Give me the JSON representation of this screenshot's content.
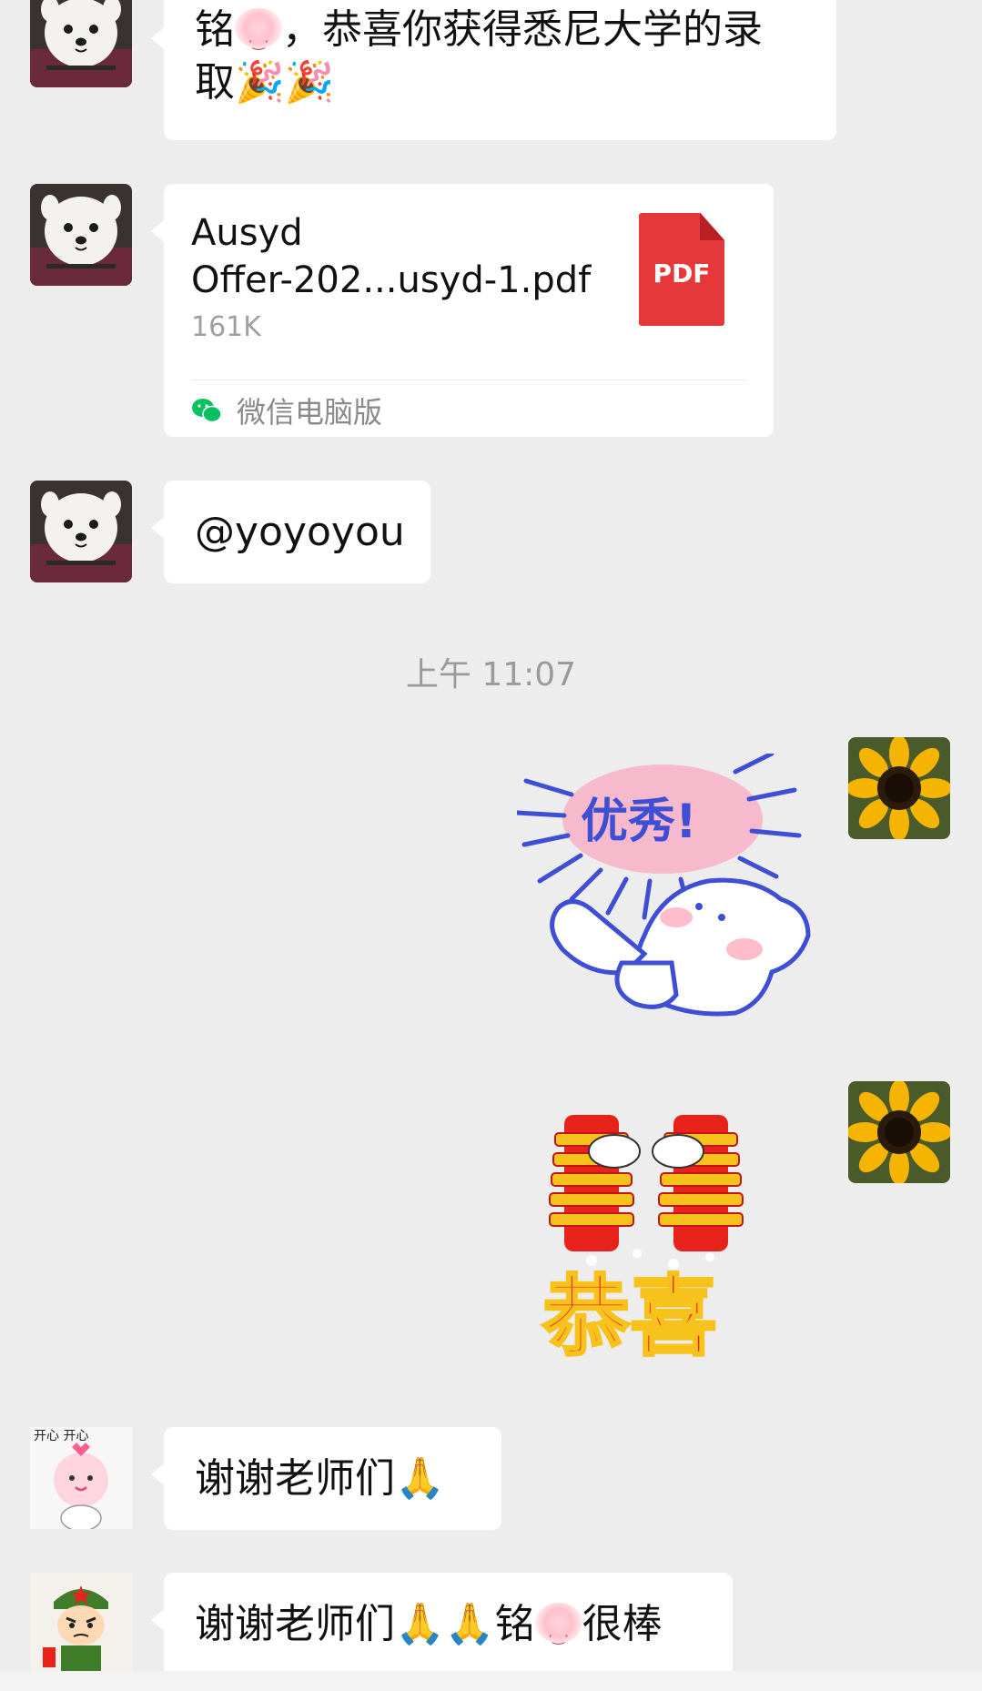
{
  "messages": {
    "m1": {
      "text_a": "铭",
      "text_b": "，恭喜你获得悉尼大学的录",
      "text_c": "取",
      "emoji": "🎉🎉"
    },
    "m2": {
      "file_name_line1": "Ausyd",
      "file_name_line2": "Offer-202...usyd-1.pdf",
      "file_size": "161K",
      "file_type": "PDF",
      "source": "微信电脑版"
    },
    "m3": {
      "text": "@yoyoyou"
    },
    "timestamp": "上午 11:07",
    "m4": {
      "sticker_text": "优秀!"
    },
    "m5": {
      "sticker_text": "恭喜"
    },
    "m6": {
      "text": "谢谢老师们",
      "emoji": "🙏",
      "avatar_caption": "开心 开心"
    },
    "m7": {
      "text_a": "谢谢老师们",
      "emoji": "🙏🙏",
      "text_b": "铭",
      "text_c": "很棒"
    }
  },
  "colors": {
    "background": "#ededed",
    "bubble": "#ffffff",
    "pdf_red": "#e5383b",
    "wechat_green": "#07c160",
    "sticker_red": "#e8231c",
    "sticker_blue": "#3e4fd6"
  },
  "icons": {
    "file": "pdf-icon",
    "source": "wechat-icon"
  }
}
